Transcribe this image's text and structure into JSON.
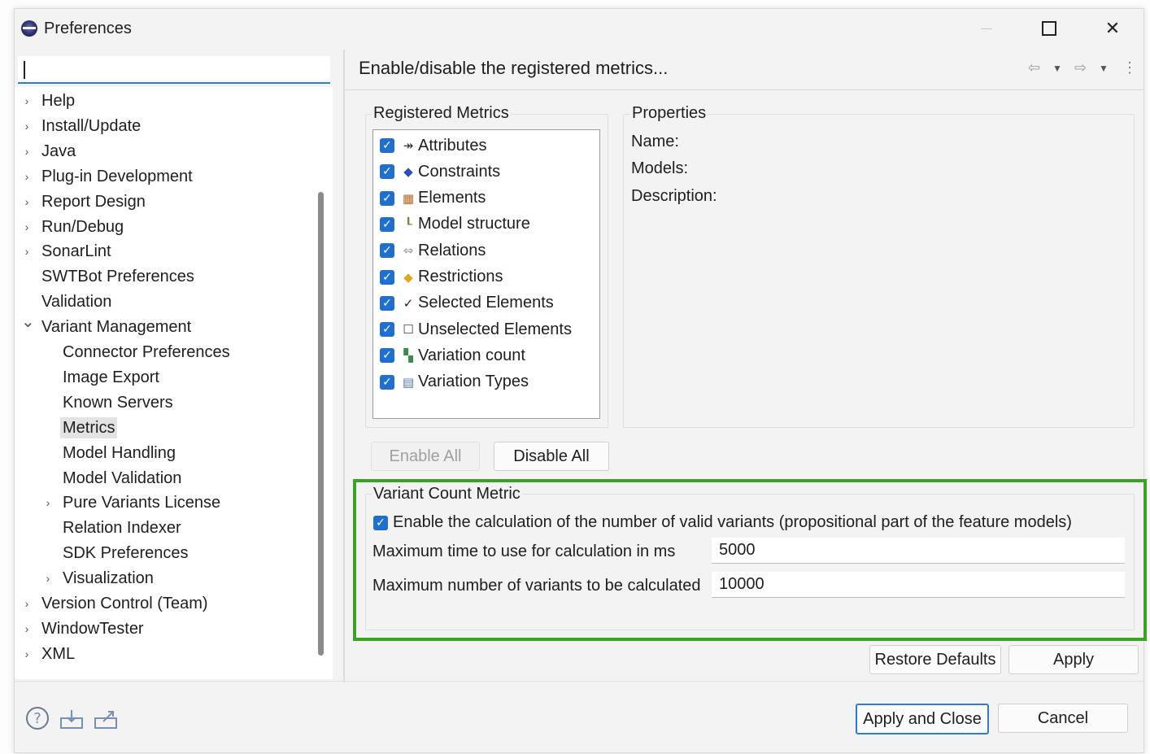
{
  "window": {
    "title": "Preferences"
  },
  "search": {
    "value": ""
  },
  "tree": [
    {
      "label": "Help",
      "expander": "collapsed",
      "level": 0
    },
    {
      "label": "Install/Update",
      "expander": "collapsed",
      "level": 0
    },
    {
      "label": "Java",
      "expander": "collapsed",
      "level": 0
    },
    {
      "label": "Plug-in Development",
      "expander": "collapsed",
      "level": 0
    },
    {
      "label": "Report Design",
      "expander": "collapsed",
      "level": 0
    },
    {
      "label": "Run/Debug",
      "expander": "collapsed",
      "level": 0
    },
    {
      "label": "SonarLint",
      "expander": "collapsed",
      "level": 0
    },
    {
      "label": "SWTBot Preferences",
      "expander": "none",
      "level": 0
    },
    {
      "label": "Validation",
      "expander": "none",
      "level": 0
    },
    {
      "label": "Variant Management",
      "expander": "expanded",
      "level": 0
    },
    {
      "label": "Connector Preferences",
      "expander": "none",
      "level": 1
    },
    {
      "label": "Image Export",
      "expander": "none",
      "level": 1
    },
    {
      "label": "Known Servers",
      "expander": "none",
      "level": 1
    },
    {
      "label": "Metrics",
      "expander": "none",
      "level": 1,
      "selected": true
    },
    {
      "label": "Model Handling",
      "expander": "none",
      "level": 1
    },
    {
      "label": "Model Validation",
      "expander": "none",
      "level": 1
    },
    {
      "label": "Pure Variants License",
      "expander": "collapsed",
      "level": 1
    },
    {
      "label": "Relation Indexer",
      "expander": "none",
      "level": 1
    },
    {
      "label": "SDK Preferences",
      "expander": "none",
      "level": 1
    },
    {
      "label": "Visualization",
      "expander": "collapsed",
      "level": 1
    },
    {
      "label": "Version Control (Team)",
      "expander": "collapsed",
      "level": 0
    },
    {
      "label": "WindowTester",
      "expander": "collapsed",
      "level": 0
    },
    {
      "label": "XML",
      "expander": "collapsed",
      "level": 0
    }
  ],
  "page": {
    "title": "Enable/disable the registered metrics..."
  },
  "registered_metrics": {
    "label": "Registered Metrics",
    "items": [
      {
        "label": "Attributes",
        "checked": true,
        "icon": "attributes-icon",
        "glyph": "↠",
        "color": "#333333"
      },
      {
        "label": "Constraints",
        "checked": true,
        "icon": "constraints-icon",
        "glyph": "◆",
        "color": "#2a4fb8"
      },
      {
        "label": "Elements",
        "checked": true,
        "icon": "elements-icon",
        "glyph": "▦",
        "color": "#b8641c"
      },
      {
        "label": "Model structure",
        "checked": true,
        "icon": "model-structure-icon",
        "glyph": "┖",
        "color": "#6a8a3a"
      },
      {
        "label": "Relations",
        "checked": true,
        "icon": "relations-icon",
        "glyph": "⇔",
        "color": "#9a9a9a"
      },
      {
        "label": "Restrictions",
        "checked": true,
        "icon": "restrictions-icon",
        "glyph": "◆",
        "color": "#e0a91a"
      },
      {
        "label": "Selected Elements",
        "checked": true,
        "icon": "checkmark-icon",
        "glyph": "✓",
        "color": "#222222"
      },
      {
        "label": "Unselected Elements",
        "checked": true,
        "icon": "empty-box-icon",
        "glyph": "☐",
        "color": "#444444"
      },
      {
        "label": "Variation count",
        "checked": true,
        "icon": "variation-count-icon",
        "glyph": "▚",
        "color": "#3a8a4a"
      },
      {
        "label": "Variation Types",
        "checked": true,
        "icon": "variation-types-icon",
        "glyph": "▤",
        "color": "#5577aa"
      }
    ]
  },
  "properties": {
    "label": "Properties",
    "name_label": "Name:",
    "models_label": "Models:",
    "description_label": "Description:"
  },
  "buttons": {
    "enable_all": "Enable All",
    "disable_all": "Disable All",
    "restore_defaults": "Restore Defaults",
    "apply": "Apply",
    "apply_and_close": "Apply and Close",
    "cancel": "Cancel"
  },
  "variant_count": {
    "label": "Variant Count Metric",
    "enable_checked": true,
    "enable_label": "Enable the calculation of the number of valid variants (propositional part of the feature models)",
    "max_time_label": "Maximum time to use for calculation in ms",
    "max_time_value": "5000",
    "max_variants_label": "Maximum number of variants to be calculated",
    "max_variants_value": "10000"
  },
  "colors": {
    "accent": "#1f6fcf",
    "highlight": "#3aa326"
  }
}
